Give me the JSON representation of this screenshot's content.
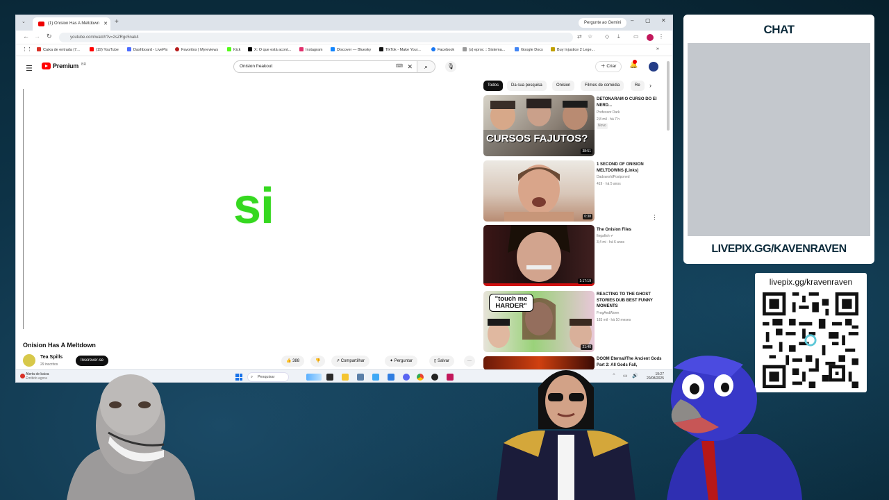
{
  "browser": {
    "tab_title": "(1) Onision Has A Meltdown",
    "gemini_button": "Pergunte ao Gemini",
    "url": "youtube.com/watch?v=2sZRgc5nak4",
    "bookmarks": [
      "Caixa de entrada (7...",
      "(19) YouTube",
      "Dashboard - LivePix",
      "Favoritos | Myreviews",
      "Kick",
      "X: O que está acont...",
      "Instagram",
      "Discover — Bluesky",
      "TikTok - Make Your...",
      "Facebook",
      "(s) eproc :: Sistema...",
      "Google Docs",
      "Buy Injustice 2 Lege..."
    ]
  },
  "youtube": {
    "logo_text": "Premium",
    "region": "BR",
    "search_value": "Onision freakout",
    "create_label": "Criar",
    "player_text": "si",
    "video_title": "Onision Has A Meltdown",
    "channel_name": "Tea Spills",
    "channel_subs": "29 inscritos",
    "subscribe_label": "Inscrever-se",
    "like_count": "388",
    "share_label": "Compartilhar",
    "ask_label": "Perguntar",
    "save_label": "Salvar",
    "chips": [
      "Todos",
      "Da sua pesquisa",
      "Onision",
      "Filmes de comédia",
      "Re"
    ],
    "recommendations": [
      {
        "title": "DETONARAM O CURSO DO EI NERD...",
        "channel": "Professor Dark",
        "meta": "2,8 mil · há 7 h",
        "badge": "Novo",
        "duration": "38:51",
        "thumb_text": "CURSOS FAJUTOS?"
      },
      {
        "title": "1 SECOND OF ONISION MELTDOWNS (Links)",
        "channel": "DadsworldPostponed",
        "meta": "419 · há 5 anos",
        "badge": "",
        "duration": "0:38",
        "thumb_text": ""
      },
      {
        "title": "The Onision Files",
        "channel": "fingafish",
        "meta": "3,4 mi · há 6 anos",
        "badge": "",
        "duration": "1:17:19",
        "thumb_text": ""
      },
      {
        "title": "REACTING TO THE GHOST STORIES DUB BEST FUNNY MOMENTS",
        "channel": "FrogAndWorm",
        "meta": "183 mil · há 10 meses",
        "badge": "",
        "duration": "21:40",
        "thumb_text": "\"touch me HARDER\""
      },
      {
        "title": "DOOM Eternal/The Ancient Gods Part 2: All Gods Fall,",
        "channel": "",
        "meta": "",
        "badge": "",
        "duration": "",
        "thumb_text": ""
      }
    ]
  },
  "taskbar": {
    "alert_title": "Alerta de baixa",
    "alert_sub": "Emitido agora",
    "search_placeholder": "Pesquisar",
    "time": "19:27",
    "date": "20/08/2025"
  },
  "overlay": {
    "chat_title": "CHAT",
    "chat_url": "LIVEPIX.GG/KAVENRAVEN",
    "qr_url": "livepix.gg/kravenraven"
  },
  "colors": {
    "background": "#0c2c3b",
    "yt_red": "#ff0000",
    "player_text": "#35d81f",
    "chat_body": "#c4c8cd"
  }
}
